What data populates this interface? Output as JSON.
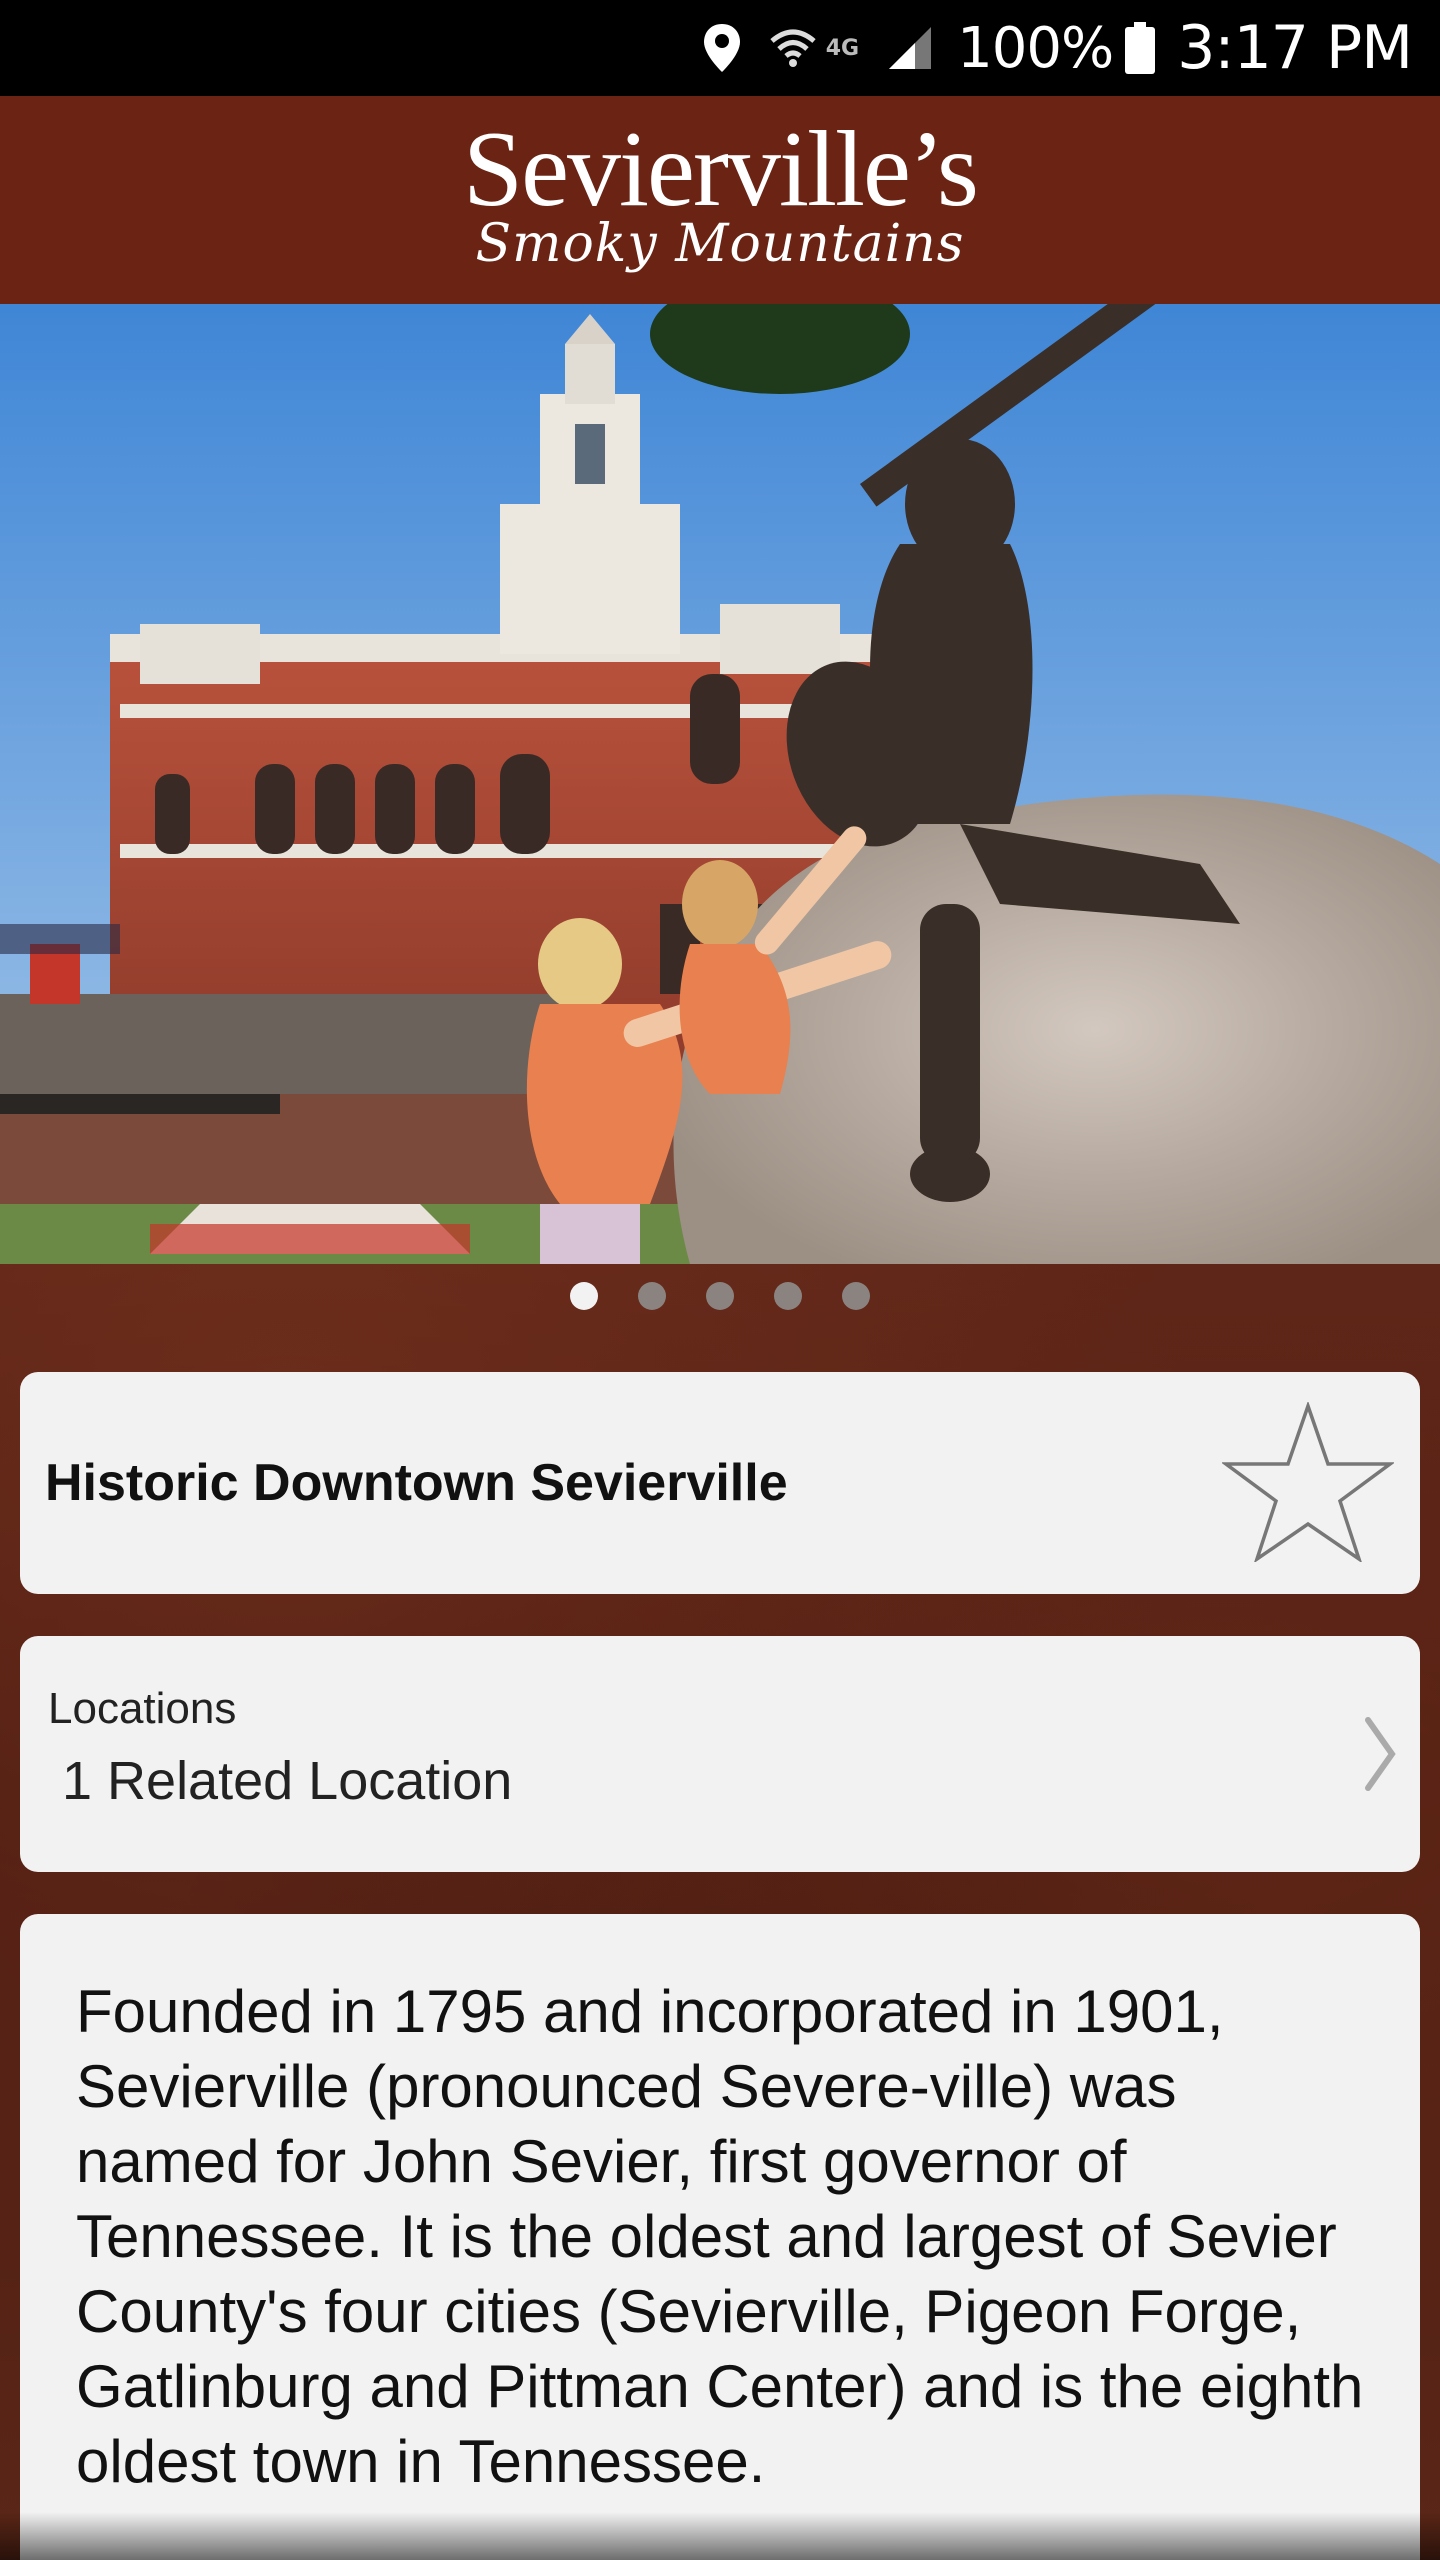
{
  "status_bar": {
    "network_type": "4G",
    "battery": "100%",
    "time": "3:17 PM",
    "icons": [
      "location-icon",
      "wifi-icon",
      "signal-icon",
      "battery-icon"
    ]
  },
  "header": {
    "logo_main": "Sevierville’s",
    "logo_sub": "Smoky Mountains"
  },
  "carousel": {
    "image": "courthouse-and-guitar-statue-photo",
    "slide_count": 5,
    "active_index": 0
  },
  "title_card": {
    "title": "Historic Downtown Sevierville",
    "favorite_icon": "star-outline-icon"
  },
  "locations_card": {
    "label": "Locations",
    "value": "1 Related Location",
    "icon": "chevron-right-icon"
  },
  "description": {
    "text": "Founded in 1795 and incorporated in 1901, Sevierville (pronounced Severe-ville) was named for John Sevier, first governor of Tennessee. It is the oldest and largest of Sevier County's four cities (Sevierville, Pigeon Forge, Gatlinburg and Pittman Center) and is the eighth oldest town in Tennessee."
  },
  "colors": {
    "header_bg": "#6b2314",
    "card_bg": "#f2f2f2",
    "status_bar_bg": "#000000"
  }
}
